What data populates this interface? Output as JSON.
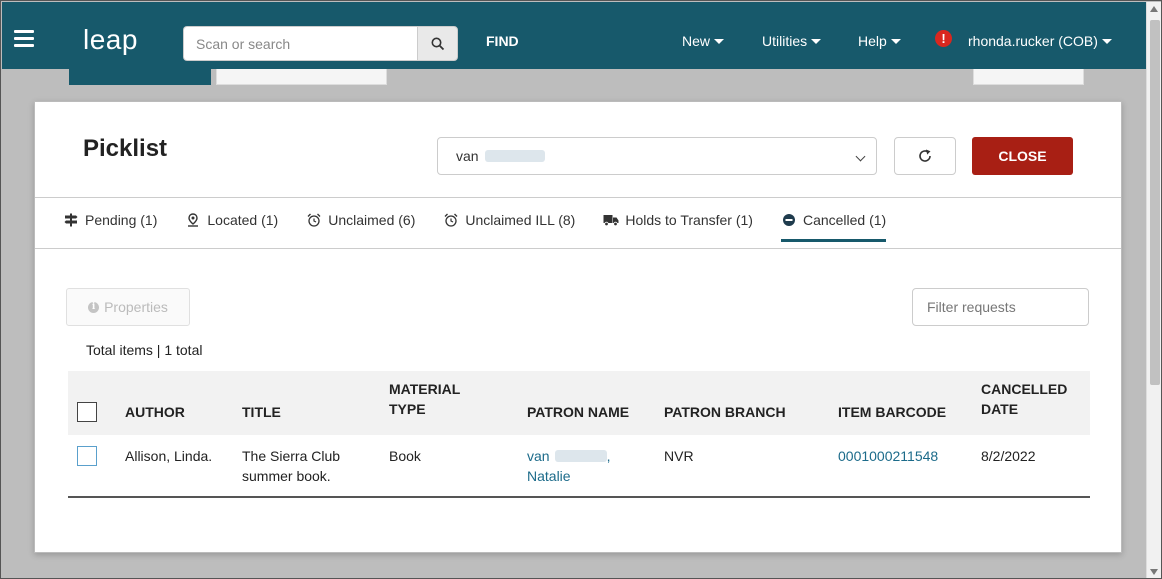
{
  "topnav": {
    "logo": "leap",
    "search_placeholder": "Scan or search",
    "find_label": "FIND",
    "menus": [
      {
        "label": "New"
      },
      {
        "label": "Utilities"
      },
      {
        "label": "Help"
      }
    ],
    "alert_glyph": "!",
    "user_label": "rhonda.rucker (COB)"
  },
  "modal": {
    "title": "Picklist",
    "patron_select_value": "van",
    "close_label": "CLOSE",
    "tabs": [
      {
        "label": "Pending (1)",
        "icon": "signpost-icon"
      },
      {
        "label": "Located (1)",
        "icon": "map-marker-icon"
      },
      {
        "label": "Unclaimed (6)",
        "icon": "alarm-clock-icon"
      },
      {
        "label": "Unclaimed ILL (8)",
        "icon": "alarm-clock-icon"
      },
      {
        "label": "Holds to Transfer (1)",
        "icon": "truck-icon"
      },
      {
        "label": "Cancelled (1)",
        "icon": "minus-circle-icon",
        "active": true
      }
    ],
    "properties_label": "Properties",
    "filter_placeholder": "Filter requests",
    "total_text": "Total items | 1 total",
    "table": {
      "headers": {
        "author": "AUTHOR",
        "title": "TITLE",
        "material_type_1": "MATERIAL",
        "material_type_2": "TYPE",
        "patron_name": "PATRON NAME",
        "patron_branch": "PATRON BRANCH",
        "item_barcode": "ITEM BARCODE",
        "cancelled_date_1": "CANCELLED",
        "cancelled_date_2": "DATE"
      },
      "rows": [
        {
          "author": "Allison, Linda.",
          "title_1": "The Sierra Club",
          "title_2": "summer book.",
          "material_type": "Book",
          "patron_name_1": "van",
          "patron_name_sep": ",",
          "patron_name_2": "Natalie",
          "patron_branch": "NVR",
          "item_barcode": "0001000211548",
          "cancelled_date": "8/2/2022"
        }
      ]
    }
  }
}
